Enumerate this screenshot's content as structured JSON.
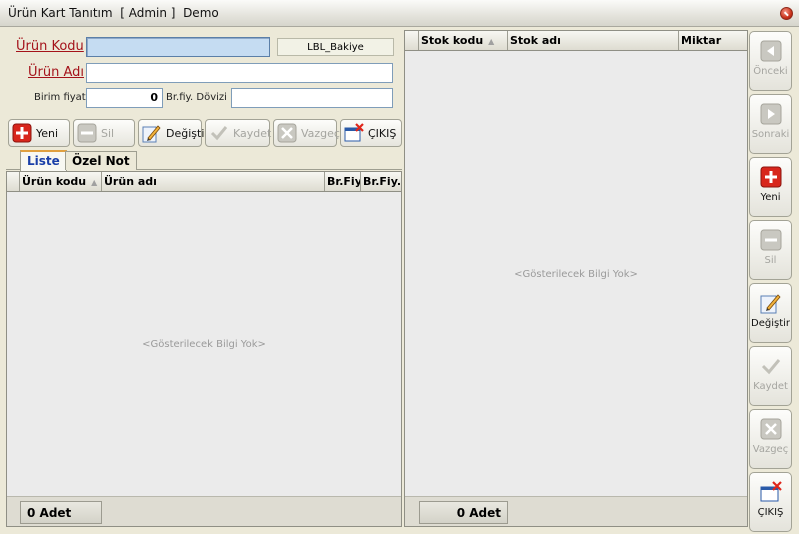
{
  "window": {
    "title": "Ürün Kart Tanıtım  [ Admin ]  Demo"
  },
  "form": {
    "urun_kodu_label": "Ürün Kodu",
    "urun_kodu_value": "",
    "bakiye_label": "LBL_Bakiye",
    "urun_adi_label": "Ürün Adı",
    "urun_adi_value": "",
    "birim_fiyati_label": "Birim fiyatı",
    "birim_fiyati_value": "0",
    "br_fiy_dovizi_label": "Br.fiy. Dövizi",
    "br_fiy_dovizi_value": ""
  },
  "toolbar": {
    "yeni": "Yeni",
    "sil": "Sil",
    "degistir": "Değiştir",
    "kaydet": "Kaydet",
    "vazgec": "Vazgeç",
    "cikis": "ÇIKIŞ"
  },
  "tabs": [
    "Liste",
    "Özel Not"
  ],
  "left_grid": {
    "columns": [
      "Ürün kodu",
      "Ürün adı",
      "Br.Fiy",
      "Br.Fiy."
    ],
    "empty_text": "<Gösterilecek Bilgi Yok>",
    "count": "0 Adet"
  },
  "right_grid": {
    "columns": [
      "Stok kodu",
      "Stok adı",
      "Miktar"
    ],
    "empty_text": "<Gösterilecek Bilgi Yok>",
    "count": "0 Adet"
  },
  "side_buttons": {
    "onceki": "Önceki",
    "sonraki": "Sonraki",
    "yeni": "Yeni",
    "sil": "Sil",
    "degistir": "Değiştir",
    "kaydet": "Kaydet",
    "vazgec": "Vazgeç",
    "cikis": "ÇIKIŞ"
  },
  "icons": [
    "close-icon",
    "plus-icon",
    "minus-icon",
    "pencil-icon",
    "check-icon",
    "x-icon",
    "exit-icon",
    "arrow-left-icon",
    "arrow-right-icon",
    "sort-arrow-icon"
  ],
  "colors": {
    "label_red": "#a4121a",
    "focus_blue": "#c5dcf2",
    "tab_active": "#1a3fa8"
  }
}
